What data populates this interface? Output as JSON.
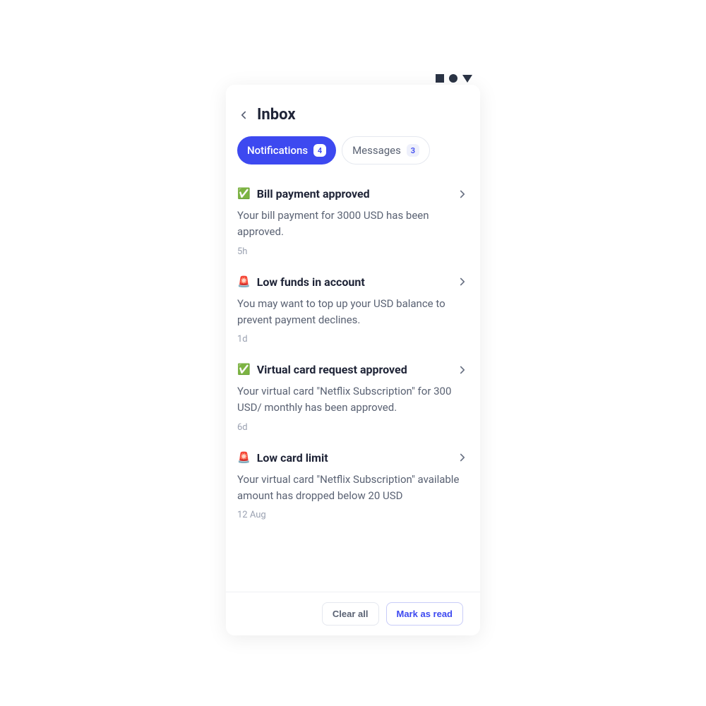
{
  "header": {
    "title": "Inbox"
  },
  "tabs": {
    "notifications": {
      "label": "Notifications",
      "count": "4"
    },
    "messages": {
      "label": "Messages",
      "count": "3"
    }
  },
  "notifications": [
    {
      "emoji": "✅",
      "title": "Bill payment approved",
      "body": "Your bill payment for 3000 USD has been approved.",
      "time": "5h"
    },
    {
      "emoji": "🚨",
      "title": "Low funds in account",
      "body": "You may want to top up your USD balance to prevent payment declines.",
      "time": "1d"
    },
    {
      "emoji": "✅",
      "title": "Virtual card request approved",
      "body": "Your virtual card \"Netflix Subscription\" for 300 USD/ monthly has been approved.",
      "time": "6d"
    },
    {
      "emoji": "🚨",
      "title": "Low card limit",
      "body": "Your virtual card \"Netflix Subscription\" available amount has dropped below 20 USD",
      "time": "12 Aug"
    }
  ],
  "footer": {
    "clear": "Clear all",
    "mark": "Mark as read"
  }
}
